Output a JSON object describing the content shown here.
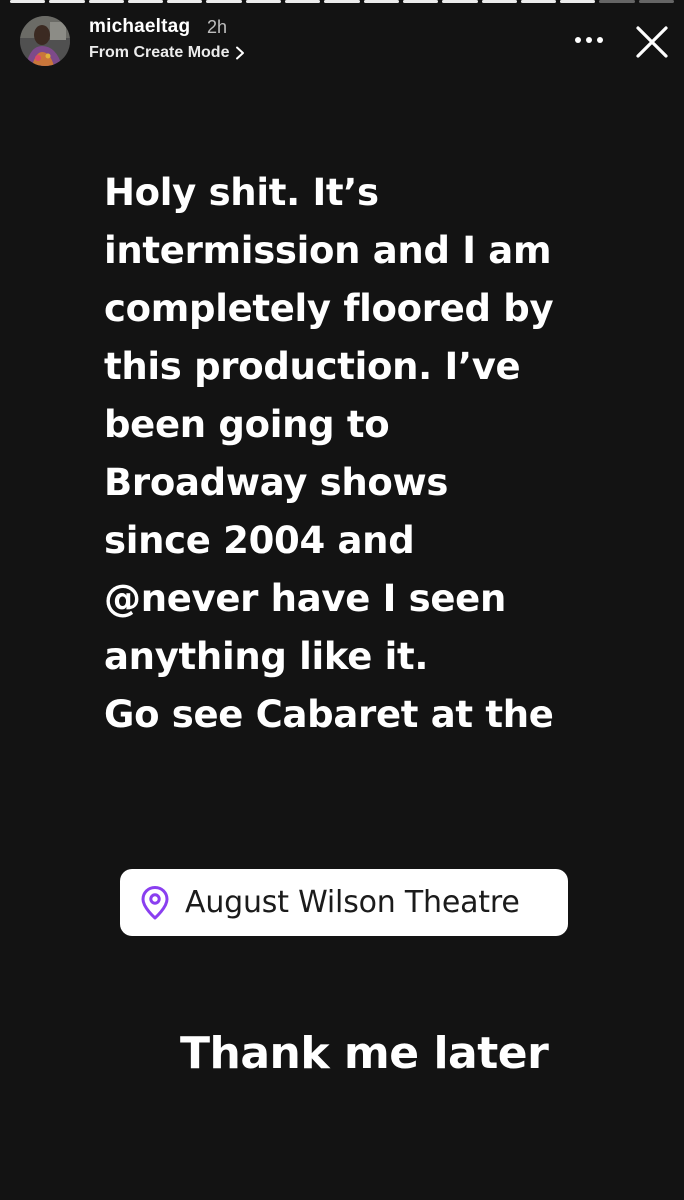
{
  "story": {
    "progress": {
      "segments_total": 17,
      "segments_viewed": 15
    },
    "header": {
      "username": "michaeltag",
      "time_ago": "2h",
      "subtitle": "From Create Mode",
      "icons": {
        "avatar": "profile-photo",
        "subtitle_chevron": "chevron-right-icon",
        "more": "more-dots-icon",
        "close": "close-icon"
      }
    },
    "text_lines": [
      "Holy shit. It’s",
      "intermission and I am",
      "completely floored by",
      "this production. I’ve",
      "been going to",
      "Broadway shows",
      "since 2004 and",
      "@never have I seen",
      "anything like it.",
      "Go see Cabaret at the"
    ],
    "location_sticker": {
      "name": "August Wilson Theatre",
      "icon": "location-pin-icon",
      "accent_color": "#8a3ff0"
    },
    "closing_text": "Thank me later"
  },
  "colors": {
    "background": "#131313",
    "text": "#ffffff",
    "sticker_background": "#ffffff"
  }
}
